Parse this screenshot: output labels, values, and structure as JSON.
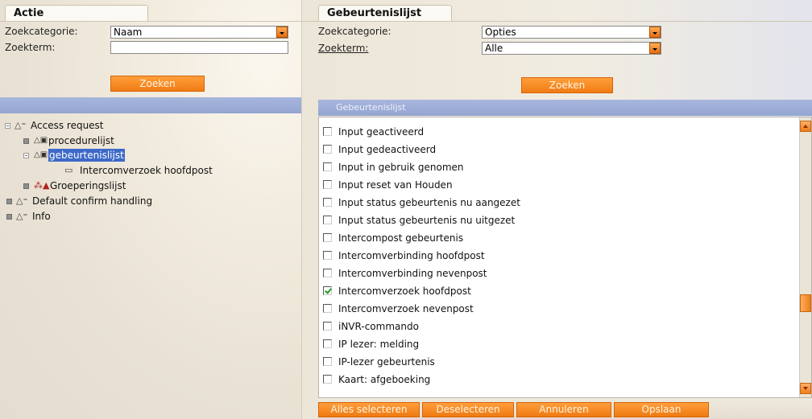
{
  "left": {
    "tab_label": "Actie",
    "category_label": "Zoekcategorie:",
    "category_value": "Naam",
    "term_label": "Zoekterm:",
    "term_value": "",
    "search_button": "Zoeken",
    "tree": [
      {
        "label": "Access request",
        "icon": "triangle-icon"
      },
      {
        "label": "procedurelijst",
        "icon": "lock-icon"
      },
      {
        "label": "gebeurtenislijst",
        "icon": "lock-icon",
        "selected": true
      },
      {
        "label": "Intercomverzoek hoofdpost",
        "icon": "card-icon"
      },
      {
        "label": "Groeperingslijst",
        "icon": "group-icon"
      },
      {
        "label": "Default confirm handling",
        "icon": "triangle-icon"
      },
      {
        "label": "Info",
        "icon": "triangle-icon"
      }
    ]
  },
  "right": {
    "tab_label": "Gebeurtenislijst",
    "category_label": "Zoekcategorie:",
    "category_value": "Opties",
    "term_label": "Zoekterm:",
    "term_value": "Alle",
    "search_button": "Zoeken",
    "list_title": "Gebeurtenislijst",
    "items": [
      {
        "label": "Input geactiveerd",
        "checked": false
      },
      {
        "label": "Input gedeactiveerd",
        "checked": false
      },
      {
        "label": "Input in gebruik genomen",
        "checked": false
      },
      {
        "label": "Input reset van Houden",
        "checked": false
      },
      {
        "label": "Input status gebeurtenis nu aangezet",
        "checked": false
      },
      {
        "label": "Input status gebeurtenis nu uitgezet",
        "checked": false
      },
      {
        "label": "Intercompost gebeurtenis",
        "checked": false
      },
      {
        "label": "Intercomverbinding hoofdpost",
        "checked": false
      },
      {
        "label": "Intercomverbinding nevenpost",
        "checked": false
      },
      {
        "label": "Intercomverzoek hoofdpost",
        "checked": true
      },
      {
        "label": "Intercomverzoek nevenpost",
        "checked": false
      },
      {
        "label": "iNVR-commando",
        "checked": false
      },
      {
        "label": "IP lezer: melding",
        "checked": false
      },
      {
        "label": "IP-lezer gebeurtenis",
        "checked": false
      },
      {
        "label": "Kaart: afgeboeking",
        "checked": false
      }
    ],
    "buttons": {
      "select_all": "Alles selecteren",
      "deselect": "Deselecteren",
      "cancel": "Annuleren",
      "save": "Opslaan"
    }
  },
  "colors": {
    "accent_orange": "#f07c14",
    "selection_blue": "#3d69c8",
    "header_blue": "#9aaad4",
    "check_green": "#1f9a1f"
  }
}
